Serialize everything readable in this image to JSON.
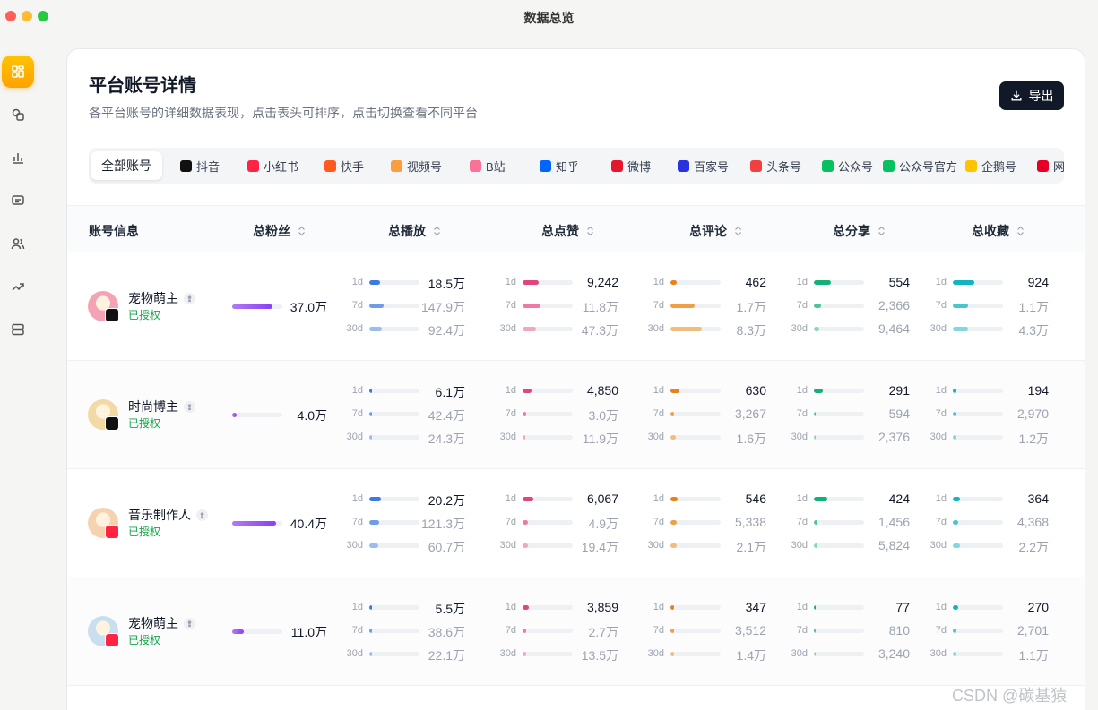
{
  "window": {
    "title": "数据总览"
  },
  "sidebar": {
    "items": [
      {
        "icon": "grid-icon",
        "active": true
      },
      {
        "icon": "layers-icon",
        "active": false
      },
      {
        "icon": "bar-chart-icon",
        "active": false
      },
      {
        "icon": "message-icon",
        "active": false
      },
      {
        "icon": "users-icon",
        "active": false
      },
      {
        "icon": "trend-icon",
        "active": false
      },
      {
        "icon": "storage-icon",
        "active": false
      }
    ]
  },
  "card": {
    "title": "平台账号详情",
    "subtitle": "各平台账号的详细数据表现，点击表头可排序，点击切换查看不同平台",
    "export_label": "导出"
  },
  "tabs": [
    {
      "label": "全部账号",
      "active": true,
      "color": ""
    },
    {
      "label": "抖音",
      "color": "#111111"
    },
    {
      "label": "小红书",
      "color": "#ff2442"
    },
    {
      "label": "快手",
      "color": "#ff5a1f"
    },
    {
      "label": "视频号",
      "color": "#fa9d3b"
    },
    {
      "label": "B站",
      "color": "#fb7299"
    },
    {
      "label": "知乎",
      "color": "#0066ff"
    },
    {
      "label": "微博",
      "color": "#e6162d"
    },
    {
      "label": "百家号",
      "color": "#2932e1"
    },
    {
      "label": "头条号",
      "color": "#f04142"
    },
    {
      "label": "公众号",
      "color": "#07c160"
    },
    {
      "label": "公众号官方",
      "color": "#07c160"
    },
    {
      "label": "企鹅号",
      "color": "#ffc300"
    },
    {
      "label": "网",
      "color": "#e60026"
    }
  ],
  "table": {
    "headers": {
      "account": "账号信息",
      "fans": "总粉丝",
      "plays": "总播放",
      "likes": "总点赞",
      "comments": "总评论",
      "shares": "总分享",
      "favorites": "总收藏"
    },
    "period_labels": [
      "1d",
      "7d",
      "30d"
    ],
    "rows": [
      {
        "name": "宠物萌主",
        "status": "已授权",
        "platform": "douyin",
        "fans": "37.0万",
        "fans_fill": 0.8,
        "plays": [
          "18.5万",
          "147.9万",
          "92.4万"
        ],
        "plays_fill": [
          0.22,
          0.28,
          0.25
        ],
        "likes": [
          "9,242",
          "11.8万",
          "47.3万"
        ],
        "likes_fill": [
          0.32,
          0.35,
          0.26
        ],
        "comments": [
          "462",
          "1.7万",
          "8.3万"
        ],
        "comments_fill": [
          0.13,
          0.48,
          0.62
        ],
        "shares": [
          "554",
          "2,366",
          "9,464"
        ],
        "shares_fill": [
          0.34,
          0.14,
          0.1
        ],
        "favorites": [
          "924",
          "1.1万",
          "4.3万"
        ],
        "favorites_fill": [
          0.42,
          0.3,
          0.3
        ]
      },
      {
        "name": "时尚博主",
        "status": "已授权",
        "platform": "douyin",
        "fans": "4.0万",
        "fans_fill": 0.09,
        "plays": [
          "6.1万",
          "42.4万",
          "24.3万"
        ],
        "plays_fill": [
          0.06,
          0.06,
          0.06
        ],
        "likes": [
          "4,850",
          "3.0万",
          "11.9万"
        ],
        "likes_fill": [
          0.17,
          0.08,
          0.06
        ],
        "comments": [
          "630",
          "3,267",
          "1.6万"
        ],
        "comments_fill": [
          0.17,
          0.08,
          0.1
        ],
        "shares": [
          "291",
          "594",
          "2,376"
        ],
        "shares_fill": [
          0.18,
          0.04,
          0.04
        ],
        "favorites": [
          "194",
          "2,970",
          "1.2万"
        ],
        "favorites_fill": [
          0.08,
          0.08,
          0.08
        ]
      },
      {
        "name": "音乐制作人",
        "status": "已授权",
        "platform": "xiaohongshu",
        "fans": "40.4万",
        "fans_fill": 0.88,
        "plays": [
          "20.2万",
          "121.3万",
          "60.7万"
        ],
        "plays_fill": [
          0.23,
          0.2,
          0.17
        ],
        "likes": [
          "6,067",
          "4.9万",
          "19.4万"
        ],
        "likes_fill": [
          0.22,
          0.11,
          0.11
        ],
        "comments": [
          "546",
          "5,338",
          "2.1万"
        ],
        "comments_fill": [
          0.15,
          0.12,
          0.13
        ],
        "shares": [
          "424",
          "1,456",
          "5,824"
        ],
        "shares_fill": [
          0.26,
          0.07,
          0.07
        ],
        "favorites": [
          "364",
          "4,368",
          "2.2万"
        ],
        "favorites_fill": [
          0.15,
          0.11,
          0.15
        ]
      },
      {
        "name": "宠物萌主",
        "status": "已授权",
        "platform": "xiaohongshu",
        "fans": "11.0万",
        "fans_fill": 0.24,
        "plays": [
          "5.5万",
          "38.6万",
          "22.1万"
        ],
        "plays_fill": [
          0.05,
          0.05,
          0.05
        ],
        "likes": [
          "3,859",
          "2.7万",
          "13.5万"
        ],
        "likes_fill": [
          0.13,
          0.07,
          0.07
        ],
        "comments": [
          "347",
          "3,512",
          "1.4万"
        ],
        "comments_fill": [
          0.08,
          0.08,
          0.08
        ],
        "shares": [
          "77",
          "810",
          "3,240"
        ],
        "shares_fill": [
          0.04,
          0.04,
          0.04
        ],
        "favorites": [
          "270",
          "2,701",
          "1.1万"
        ],
        "favorites_fill": [
          0.1,
          0.07,
          0.07
        ]
      }
    ]
  },
  "colors": {
    "plays": [
      "#3b7be0",
      "#6f9ce6",
      "#9bbcec"
    ],
    "likes": [
      "#e0457b",
      "#ec7aa2",
      "#f2a6c1"
    ],
    "comments": [
      "#e8811c",
      "#eda048",
      "#f0bd7f"
    ],
    "shares": [
      "#13b07a",
      "#4cc497",
      "#86d8b7"
    ],
    "favorites": [
      "#14b3c0",
      "#48c6d0",
      "#80d8de"
    ]
  },
  "watermark": "CSDN @碳基猿"
}
